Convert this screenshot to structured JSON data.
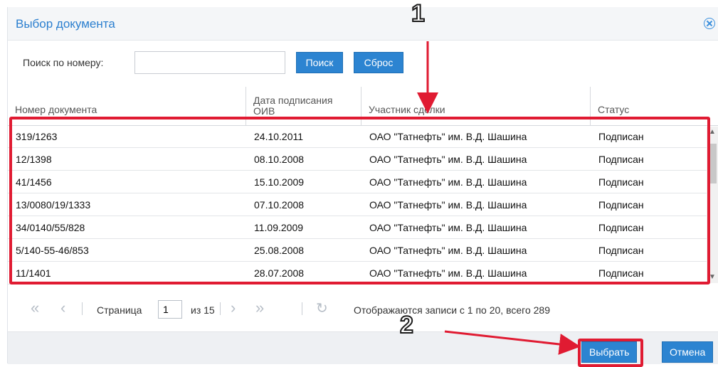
{
  "dialog": {
    "title": "Выбор документа"
  },
  "search": {
    "label": "Поиск по номеру:",
    "value": "",
    "search_button": "Поиск",
    "reset_button": "Сброс"
  },
  "columns": {
    "number": "Номер документа",
    "date": "Дата подписания\nОИВ",
    "participant": "Участник сделки",
    "status": "Статус"
  },
  "rows": [
    {
      "number": "319/1263",
      "date": "24.10.2011",
      "participant": "ОАО \"Татнефть\" им. В.Д. Шашина",
      "status": "Подписан"
    },
    {
      "number": "12/1398",
      "date": "08.10.2008",
      "participant": "ОАО \"Татнефть\" им. В.Д. Шашина",
      "status": "Подписан"
    },
    {
      "number": "41/1456",
      "date": "15.10.2009",
      "participant": "ОАО \"Татнефть\" им. В.Д. Шашина",
      "status": "Подписан"
    },
    {
      "number": "13/0080/19/1333",
      "date": "07.10.2008",
      "participant": "ОАО \"Татнефть\" им. В.Д. Шашина",
      "status": "Подписан"
    },
    {
      "number": "34/0140/55/828",
      "date": "11.09.2009",
      "participant": "ОАО \"Татнефть\" им. В.Д. Шашина",
      "status": "Подписан"
    },
    {
      "number": "5/140-55-46/853",
      "date": "25.08.2008",
      "participant": "ОАО \"Татнефть\" им. В.Д. Шашина",
      "status": "Подписан"
    },
    {
      "number": "11/1401",
      "date": "28.07.2008",
      "participant": "ОАО \"Татнефть\" им. В.Д. Шашина",
      "status": "Подписан"
    }
  ],
  "pager": {
    "page_label": "Страница",
    "page_value": "1",
    "of_label": "из 15",
    "info": "Отображаются записи с 1 по 20, всего 289"
  },
  "footer": {
    "select_button": "Выбрать",
    "cancel_button": "Отмена"
  },
  "annotations": {
    "marker_1": "1",
    "marker_2": "2",
    "highlight_color": "#e01b32"
  },
  "colors": {
    "accent": "#2c84d1",
    "title": "#2b7fcf"
  }
}
